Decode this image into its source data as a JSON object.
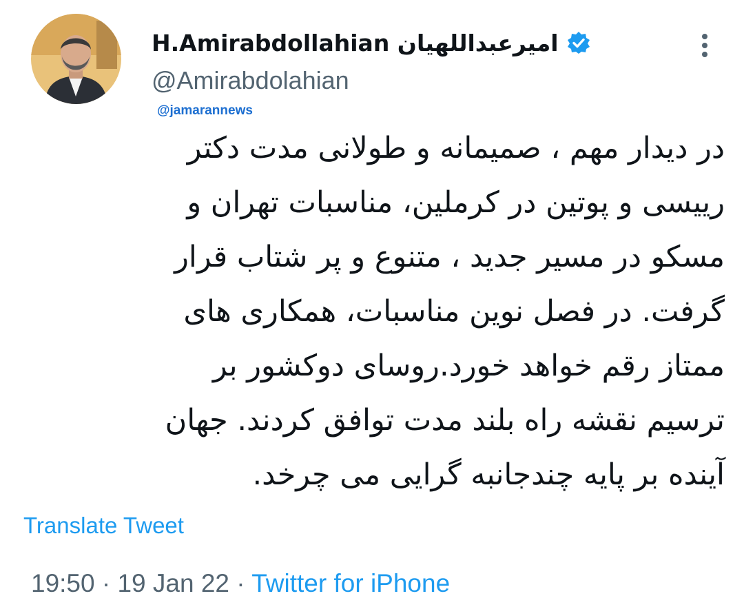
{
  "user": {
    "display_name": "H.Amirabdollahian امیرعبداللهیان",
    "handle": "@Amirabdolahian",
    "verified": true,
    "avatar_icon": "profile-photo"
  },
  "source_tag": "@jamarannews",
  "tweet": {
    "lines": [
      "در دیدار مهم ، صمیمانه و طولانی مدت دکتر",
      "رییسی و پوتین در کرملین، مناسبات تهران و",
      "مسکو  در مسیر جدید ، متنوع و پر شتاب قرار",
      "گرفت. در فصل نوین مناسبات، همکاری های",
      "ممتاز رقم خواهد خورد.روسای دوکشور بر",
      "ترسیم نقشه راه بلند مدت توافق کردند. جهان",
      "آینده بر پایه چندجانبه گرایی می چرخد."
    ],
    "translate_label": "Translate Tweet"
  },
  "meta": {
    "time": "19:50",
    "date": "19 Jan 22",
    "separator": "·",
    "source": "Twitter for iPhone"
  },
  "colors": {
    "accent": "#1d9bf0",
    "secondary_text": "#536471",
    "primary_text": "#0f1419",
    "tag": "#1d6fd1"
  }
}
